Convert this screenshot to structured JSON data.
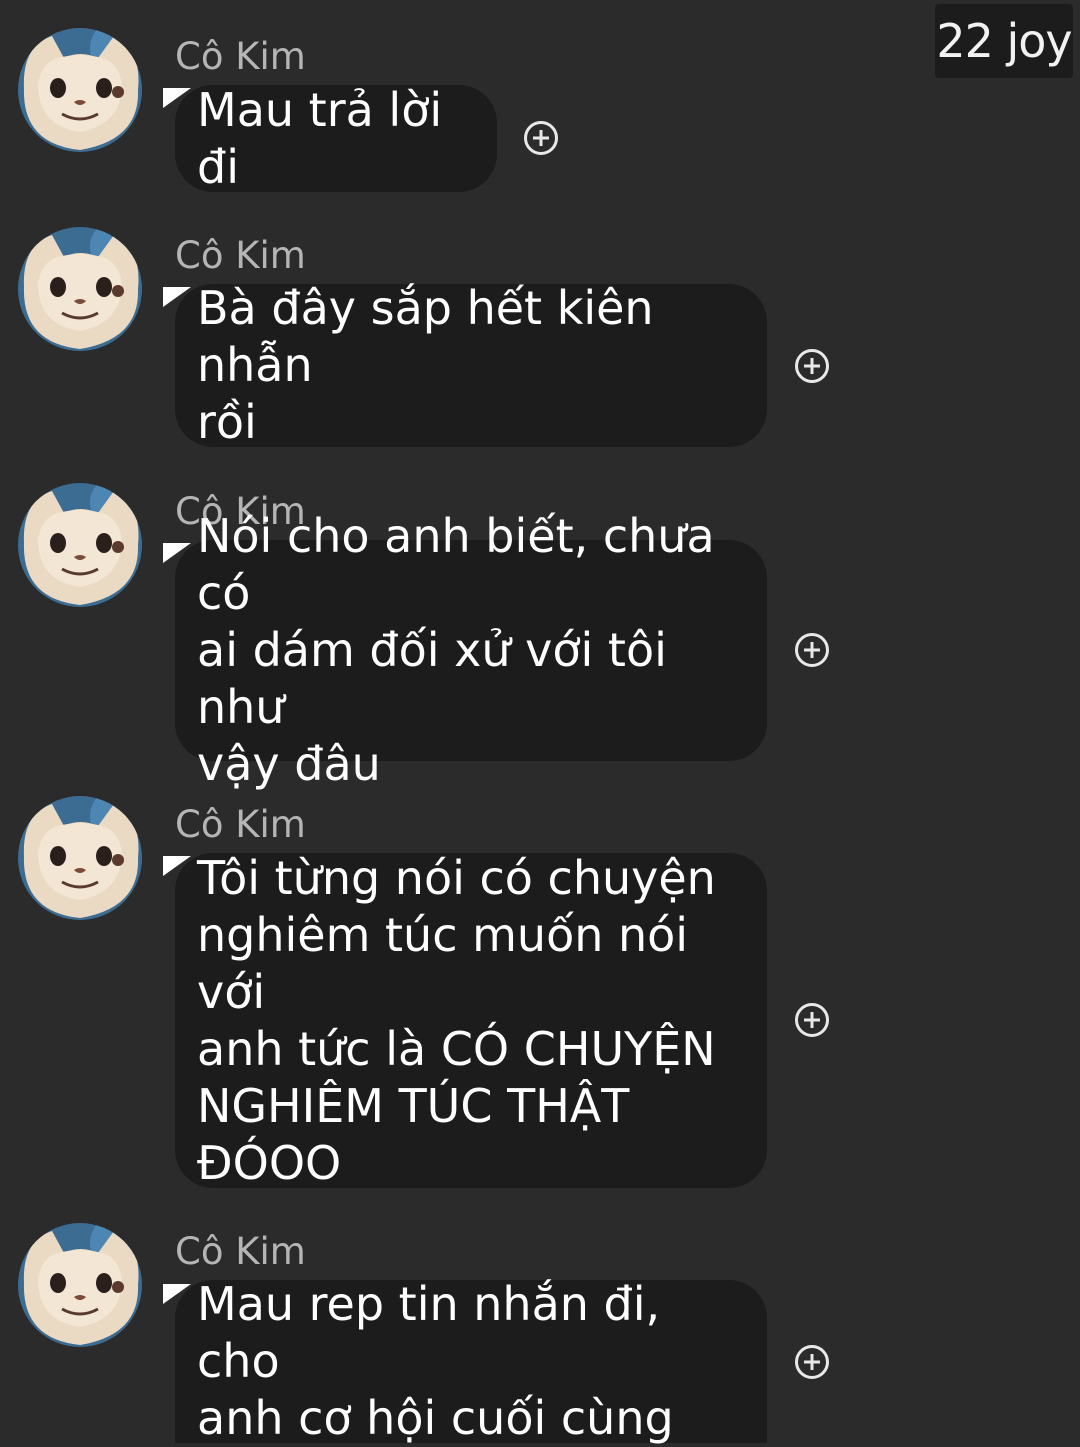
{
  "watermark": "22 joy",
  "messages": [
    {
      "sender": "Cô Kim",
      "text": "Mau trả lời đi"
    },
    {
      "sender": "Cô Kim",
      "text": "Bà đây sắp hết kiên nhẫn\nrồi"
    },
    {
      "sender": "Cô Kim",
      "text": "Nói cho anh biết, chưa có\nai dám đối xử với tôi như\nvậy đâu"
    },
    {
      "sender": "Cô Kim",
      "text": "Tôi từng nói có chuyện\nnghiêm túc muốn nói với\nanh tức là CÓ CHUYỆN\nNGHIÊM TÚC THẬT\nĐÓOO"
    },
    {
      "sender": "Cô Kim",
      "text": "Mau rep tin nhắn đi, cho\nanh cơ hội cuối cùng"
    }
  ],
  "icons": {
    "avatar": "cat-avatar-icon",
    "reaction": "add-reaction-icon"
  },
  "colors": {
    "background": "#2b2b2b",
    "bubble": "#1c1c1c",
    "sender_name": "#b5b5b5",
    "text": "#ffffff"
  }
}
